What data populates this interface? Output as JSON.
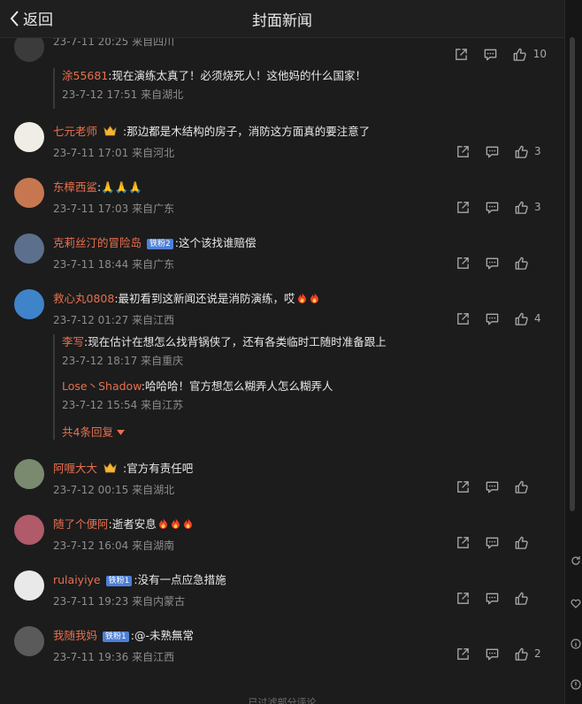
{
  "header": {
    "back_label": "返回",
    "title": "封面新闻"
  },
  "comments": [
    {
      "user": "",
      "text": "",
      "time": "23-7-11 20:25",
      "location": "来自四川",
      "likes": "10",
      "replies": [
        {
          "user": "涂55681",
          "text": ":现在演练太真了！必须烧死人！这他妈的什么国家！",
          "time": "23-7-12 17:51",
          "location": "来自湖北"
        }
      ]
    },
    {
      "user": "七元老师",
      "text": ":那边都是木结构的房子，消防这方面真的要注意了",
      "time": "23-7-11 17:01",
      "location": "来自河北",
      "likes": "3"
    },
    {
      "user": "东樟西鲨",
      "text": ":🙏🙏🙏",
      "time": "23-7-11 17:03",
      "location": "来自广东",
      "likes": "3"
    },
    {
      "user": "克莉丝汀的冒险岛",
      "badge": "铁粉2",
      "text": ":这个该找谁赔偿",
      "time": "23-7-11 18:44",
      "location": "来自广东",
      "likes": ""
    },
    {
      "user": "救心丸0808",
      "text": ":最初看到这新闻还说是消防演练，哎",
      "time": "23-7-12 01:27",
      "location": "来自江西",
      "likes": "4",
      "replies": [
        {
          "user": "李写",
          "text": ":现在估计在想怎么找背锅侠了，还有各类临时工随时准备跟上",
          "time": "23-7-12 18:17",
          "location": "来自重庆"
        },
        {
          "user": "Lose丶Shadow",
          "text": ":哈哈哈！官方想怎么糊弄人怎么糊弄人",
          "time": "23-7-12 15:54",
          "location": "来自江苏"
        }
      ],
      "more_replies": "共4条回复"
    },
    {
      "user": "阿喱大大",
      "text": ":官方有责任吧",
      "time": "23-7-12 00:15",
      "location": "来自湖北",
      "likes": ""
    },
    {
      "user": "随了个便阿",
      "text": ":逝者安息",
      "time": "23-7-12 16:04",
      "location": "来自湖南",
      "likes": ""
    },
    {
      "user": "rulaiyiye",
      "badge": "铁粉1",
      "text": ":没有一点应急措施",
      "time": "23-7-11 19:23",
      "location": "来自内蒙古",
      "likes": ""
    },
    {
      "user": "我随我妈",
      "badge": "铁粉1",
      "text": ":@-未熟無常",
      "time": "23-7-11 19:36",
      "location": "来自江西",
      "likes": "2"
    }
  ],
  "footer_note": "已过滤部分评论",
  "icons": [
    "back-arrow-icon",
    "share-icon",
    "reply-icon",
    "like-icon",
    "crown-icon",
    "fire-icon",
    "chevron-down-icon"
  ],
  "colors": {
    "background": "#1c1c1c",
    "username": "#e8704e",
    "meta": "#8d8d8d",
    "badge": "#4e7fd6"
  }
}
